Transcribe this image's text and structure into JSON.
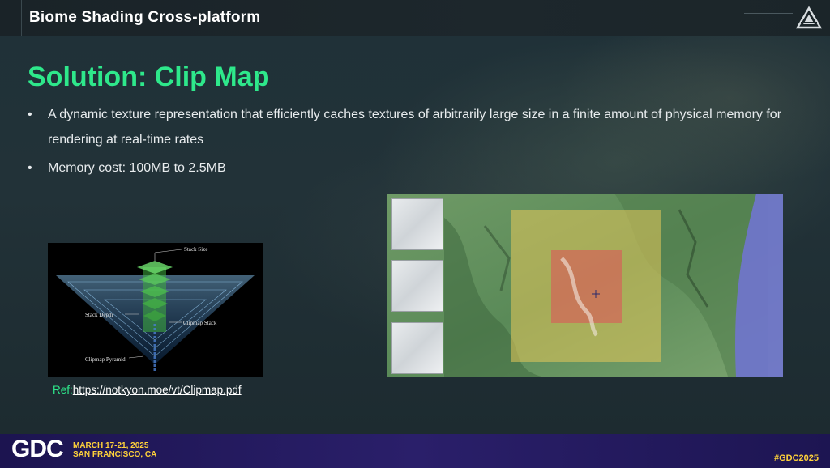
{
  "header": {
    "title": "Biome Shading Cross-platform"
  },
  "slide": {
    "title": "Solution: Clip Map",
    "bullets": [
      "A dynamic texture representation that efficiently caches textures of arbitrarily large size in a finite amount of physical memory for rendering at real-time rates",
      "Memory cost: 100MB to 2.5MB"
    ]
  },
  "figure": {
    "labels": {
      "stack_size": "Stack Size",
      "stack_depth": "Stack Depth",
      "clipmap_stack": "Clipmap Stack",
      "clipmap_pyramid": "Clipmap Pyramid"
    }
  },
  "reference": {
    "label": "Ref:",
    "link": "https://notkyon.moe/vt/Clipmap.pdf"
  },
  "footer": {
    "brand": "GDC",
    "dates": "MARCH 17-21, 2025",
    "location": "SAN FRANCISCO, CA",
    "hashtag": "#GDC2025"
  },
  "icons": {
    "brand_logo": "triangle-logo-icon",
    "bullet": "bullet-dot"
  },
  "colors": {
    "title_green": "#2ee88b",
    "footer_purple": "#241a5e",
    "footer_yellow": "#ffd23a",
    "overlay_yellow": "#e6c85a",
    "overlay_red": "#e0505a",
    "overlay_blue": "#6a6ed8"
  }
}
